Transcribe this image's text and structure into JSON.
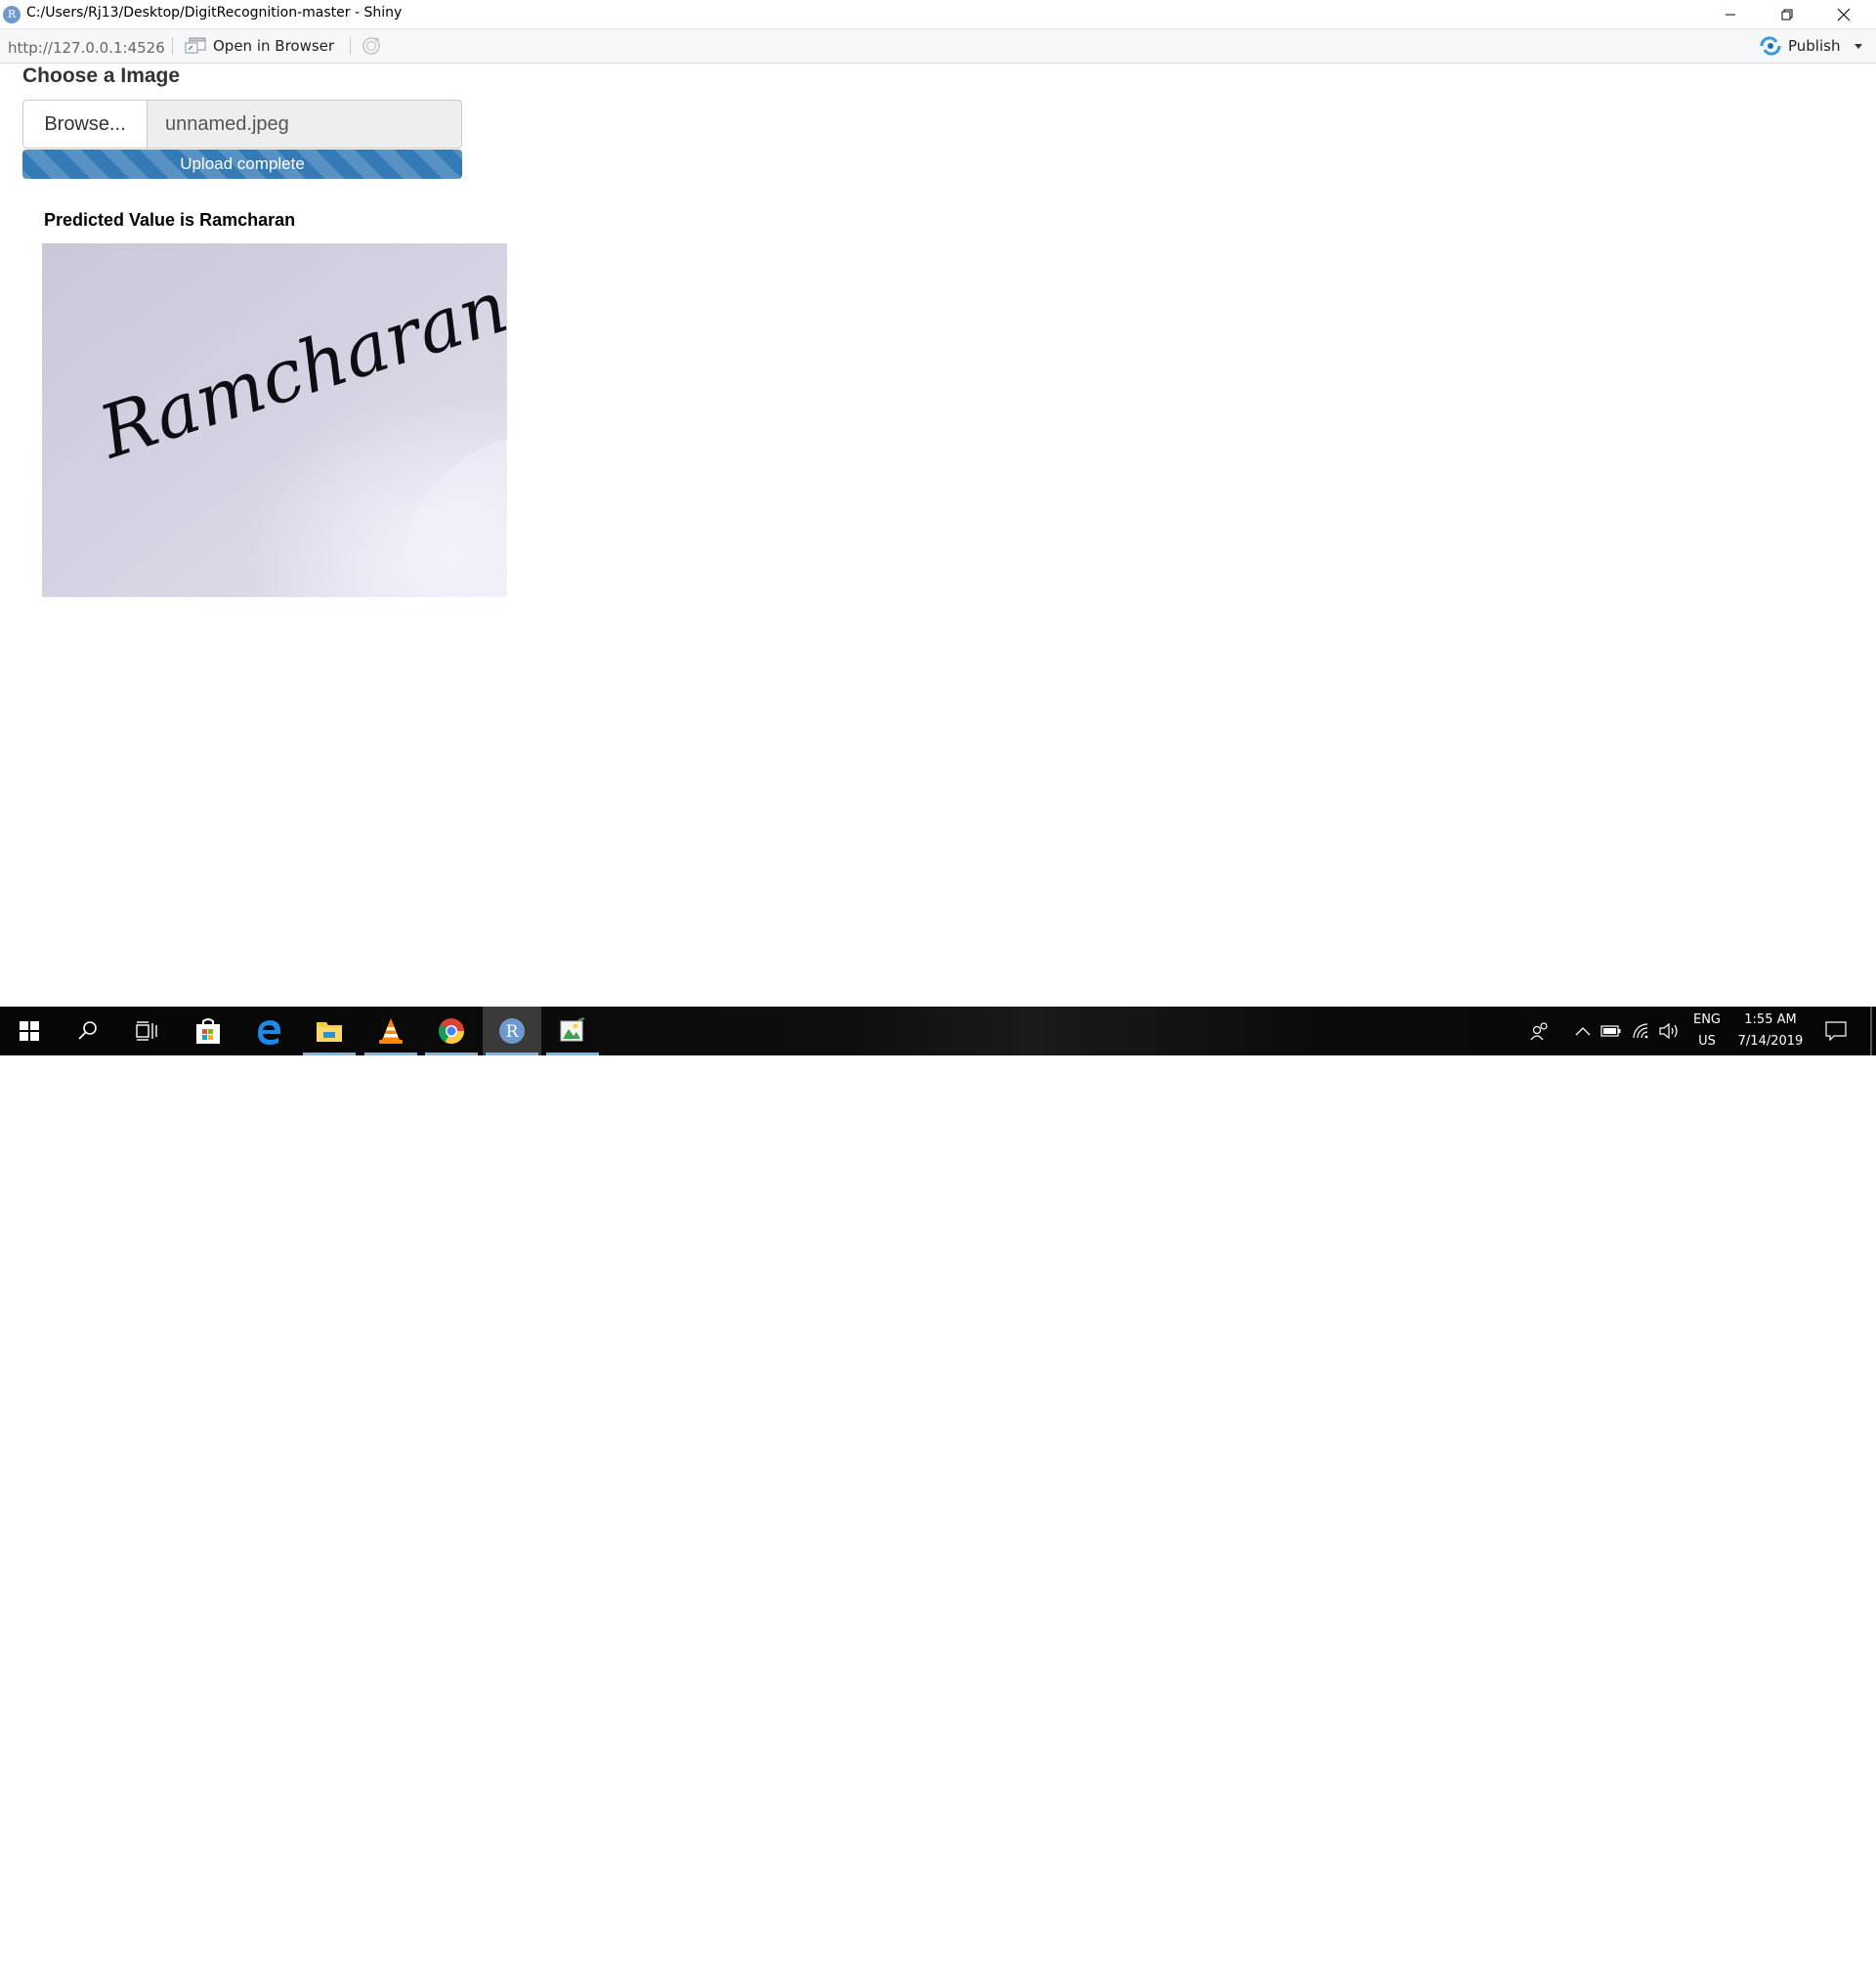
{
  "window": {
    "title": "C:/Users/Rj13/Desktop/DigitRecognition-master - Shiny",
    "app_icon_letter": "R",
    "min_icon": "minimize-icon",
    "max_icon": "restore-icon",
    "close_icon": "close-icon"
  },
  "toolbar": {
    "url": "http://127.0.0.1:4526",
    "open_in_browser_label": "Open in Browser",
    "publish_label": "Publish"
  },
  "app": {
    "heading": "Choose a Image",
    "browse_label": "Browse...",
    "file_name": "unnamed.jpeg",
    "progress_text": "Upload complete",
    "progress_fraction": 1.0,
    "prediction_text": "Predicted Value is Ramcharan",
    "signature_text": "Ramcharan"
  },
  "taskbar": {
    "apps": [
      {
        "name": "start-icon"
      },
      {
        "name": "search-icon"
      },
      {
        "name": "task-view-icon"
      },
      {
        "name": "store-icon"
      },
      {
        "name": "edge-icon"
      },
      {
        "name": "file-explorer-icon"
      },
      {
        "name": "vlc-icon"
      },
      {
        "name": "chrome-icon"
      },
      {
        "name": "r-app-icon",
        "letter": "R"
      },
      {
        "name": "image-viewer-icon"
      }
    ],
    "language": "ENG",
    "region": "US",
    "time": "1:55 AM",
    "date": "7/14/2019"
  },
  "colors": {
    "progress": "#337ab7",
    "taskbar": "#0a0a0a",
    "taskbar_underline": "#76b9ed",
    "edge_blue": "#0078d7"
  }
}
